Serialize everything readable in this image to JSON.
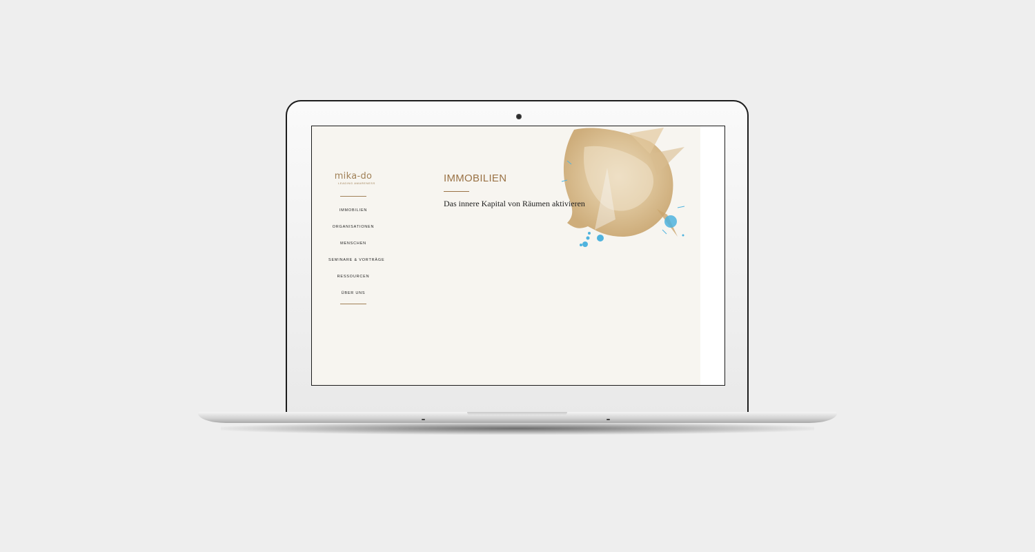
{
  "colors": {
    "brand_gold": "#a08056",
    "accent_blue": "#4fb3de",
    "page_bg": "#f7f5f0"
  },
  "logo": {
    "wordmark": "mika-do",
    "tagline": "LEADING AWARENESS"
  },
  "nav": {
    "items": [
      {
        "label": "IMMOBILIEN"
      },
      {
        "label": "ORGANISATIONEN"
      },
      {
        "label": "MENSCHEN"
      },
      {
        "label": "SEMINARE & VORTRÄGE"
      },
      {
        "label": "RESSOURCEN"
      },
      {
        "label": "ÜBER UNS"
      }
    ]
  },
  "main": {
    "title": "IMMOBILIEN",
    "subtitle": "Das innere Kapital von Räumen aktivieren"
  },
  "hero_art": {
    "icon": "watercolor-splash-art"
  }
}
